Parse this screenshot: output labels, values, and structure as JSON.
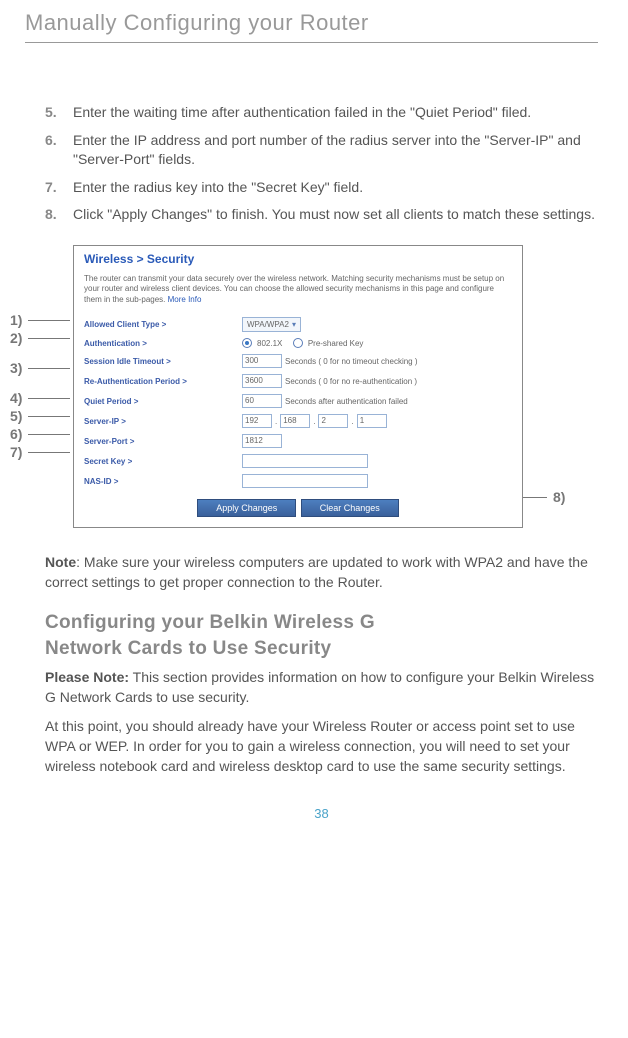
{
  "header": "Manually Configuring your Router",
  "steps": [
    {
      "num": "5.",
      "text": "Enter the waiting time after authentication failed in the \"Quiet Period\" filed."
    },
    {
      "num": "6.",
      "text": "Enter the IP address and port number of the radius server into the \"Server-IP\" and \"Server-Port\" fields."
    },
    {
      "num": "7.",
      "text": "Enter the radius key into the \"Secret Key\" field."
    },
    {
      "num": "8.",
      "text": "Click \"Apply Changes\" to finish. You must now set all clients to match these settings."
    }
  ],
  "callouts": {
    "c1": "1)",
    "c2": "2)",
    "c3": "3)",
    "c4": "4)",
    "c5": "5)",
    "c6": "6)",
    "c7": "7)",
    "c8": "8)"
  },
  "screenshot": {
    "title": "Wireless > Security",
    "desc": "The router can transmit your data securely over the wireless network. Matching security mechanisms must be setup on your router and wireless client devices. You can choose the allowed security mechanisms in this page and configure them in the sub-pages.",
    "more": "More Info",
    "rows": {
      "allowed": {
        "label": "Allowed Client Type >",
        "value": "WPA/WPA2"
      },
      "auth": {
        "label": "Authentication >",
        "opt1": "802.1X",
        "opt2": "Pre-shared Key"
      },
      "idle": {
        "label": "Session Idle Timeout >",
        "value": "300",
        "suffix": "Seconds ( 0 for no timeout checking )"
      },
      "reauth": {
        "label": "Re-Authentication Period >",
        "value": "3600",
        "suffix": "Seconds ( 0 for no re-authentication )"
      },
      "quiet": {
        "label": "Quiet Period >",
        "value": "60",
        "suffix": "Seconds after authentication failed"
      },
      "serverip": {
        "label": "Server-IP >",
        "v1": "192",
        "v2": "168",
        "v3": "2",
        "v4": "1"
      },
      "serverport": {
        "label": "Server-Port >",
        "value": "1812"
      },
      "secret": {
        "label": "Secret Key >"
      },
      "nas": {
        "label": "NAS-ID >"
      }
    },
    "apply": "Apply Changes",
    "clear": "Clear Changes"
  },
  "note_label": "Note",
  "note_text": ": Make sure your wireless computers are updated to work with WPA2 and have the correct settings to get proper connection to the Router.",
  "h2a": "Configuring your Belkin Wireless G",
  "h2b": "Network Cards to Use Security",
  "please_note_label": "Please Note:",
  "please_note_text": " This section  provides information on how to configure your Belkin Wireless G Network Cards to use security.",
  "body2": "At this point, you should already have your Wireless Router or access point set to use WPA or WEP. In order for you to gain a wireless connection, you will need to set your wireless notebook card and wireless desktop card to use the same security settings.",
  "pagenum": "38"
}
